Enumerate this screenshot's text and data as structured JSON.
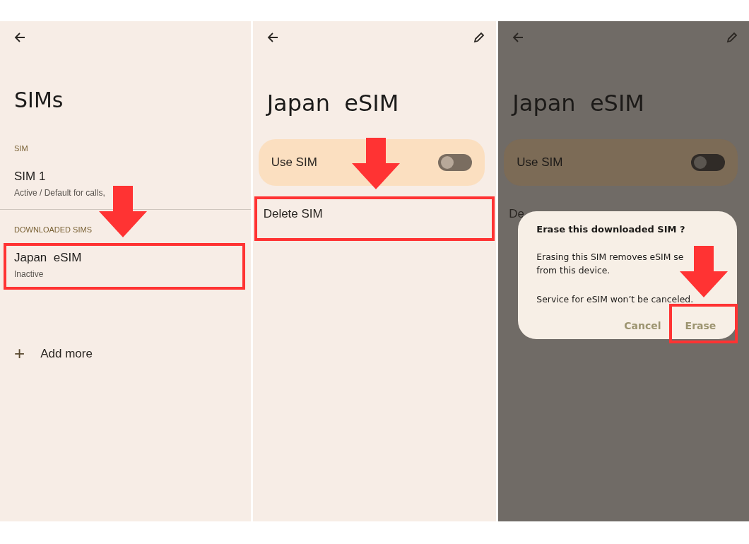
{
  "screens": [
    {
      "kind": "list",
      "title": "SIMs",
      "dimmed": false,
      "sections": [
        {
          "header": "SIM",
          "items": [
            {
              "title": "SIM 1",
              "subtitle": "Active / Default for calls,"
            }
          ]
        },
        {
          "header": "DOWNLOADED SIMS",
          "items": [
            {
              "title": "Japan  eSIM",
              "subtitle": "Inactive"
            }
          ]
        }
      ],
      "add": {
        "icon": "+",
        "label": "Add more"
      }
    },
    {
      "kind": "detail",
      "title": "Japan  eSIM",
      "dimmed": false,
      "toggle": {
        "label": "Use SIM",
        "on": false
      },
      "action": "Delete SIM"
    },
    {
      "kind": "detail",
      "title": "Japan  eSIM",
      "dimmed": true,
      "toggle": {
        "label": "Use SIM",
        "on": false
      },
      "action": "De",
      "dialog": {
        "title": "Erase this downloaded SIM ?",
        "lines": [
          "Erasing this SIM removes eSIM se",
          "from this device."
        ],
        "note": "Service for eSIM won’t be canceled.",
        "buttons": [
          "Cancel",
          "Erase"
        ]
      }
    }
  ]
}
